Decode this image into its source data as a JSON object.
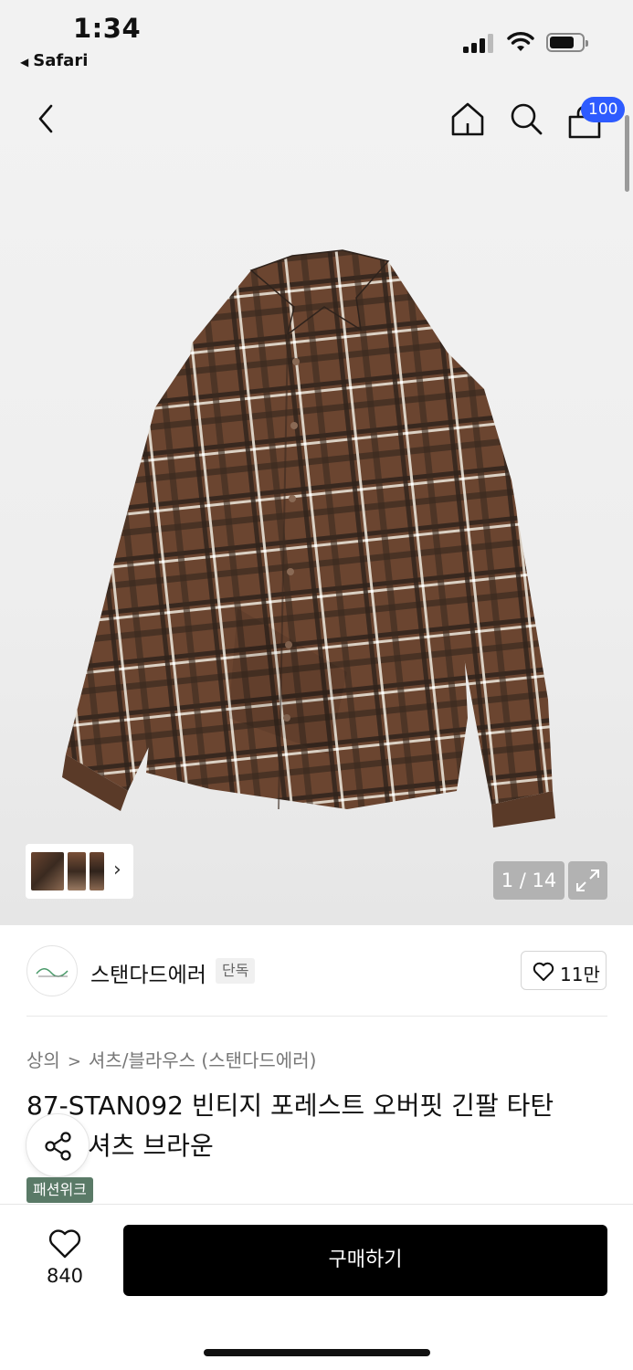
{
  "status_bar": {
    "time": "1:34",
    "back_app": "Safari",
    "battery_level": 0.75
  },
  "nav": {
    "cart_count": "100",
    "badge_color": "#2e5bff"
  },
  "gallery": {
    "counter": "1 / 14",
    "thumbnail_count": 3
  },
  "brand": {
    "name": "스탠다드에러",
    "tag": "단독",
    "likes": "11만"
  },
  "breadcrumb": {
    "category": "상의",
    "separator": ">",
    "subcategory": "셔츠/블라우스 (스탠다드에러)"
  },
  "product": {
    "title": "87-STAN092 빈티지 포레스트 오버핏 긴팔 타탄 셔츠 브라운",
    "title_line1": "87-STAN092 빈티지 포레스트 오버핏 긴팔 타탄",
    "title_line2": "셔츠 브라운",
    "promo_badge": "패션위크",
    "promo_color": "#5a7a67"
  },
  "bottom_bar": {
    "wish_count": "840",
    "buy_label": "구매하기"
  },
  "colors": {
    "shirt_base": "#6b4530",
    "shirt_dark": "#2f231c",
    "shirt_light": "#e8e0d4"
  }
}
